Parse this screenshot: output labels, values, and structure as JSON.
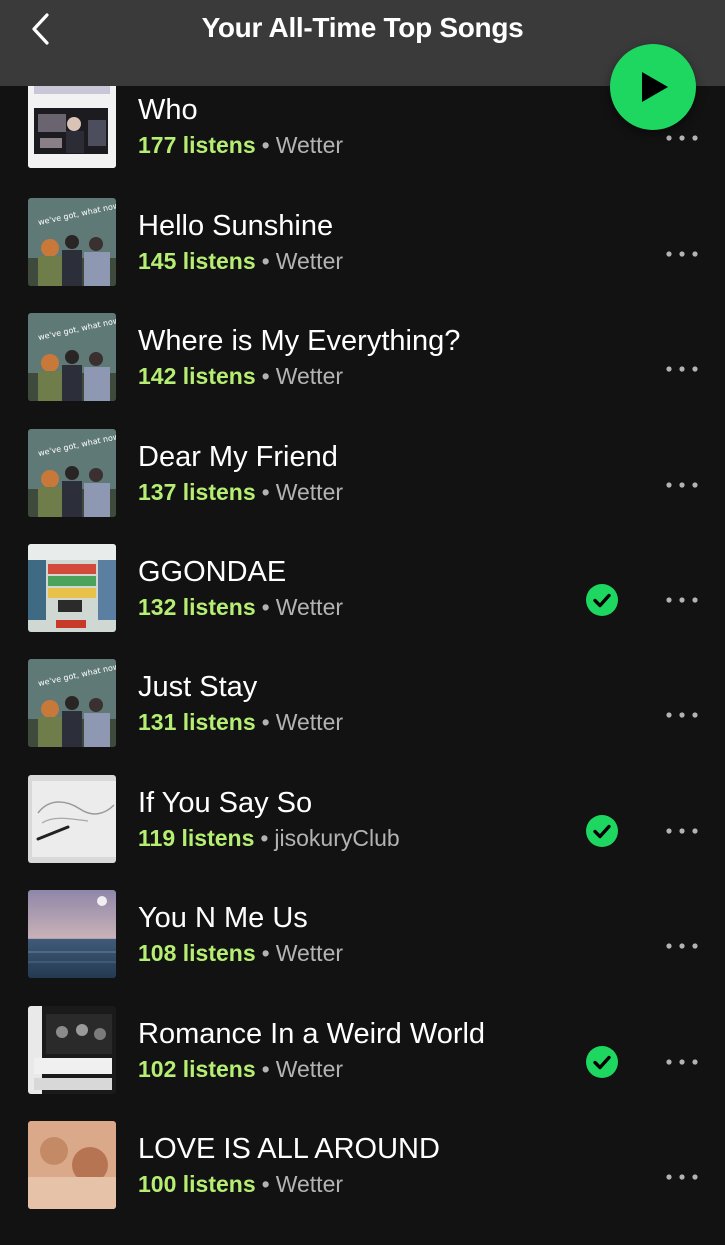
{
  "header": {
    "title": "Your All-Time Top Songs",
    "back_icon": "chevron-left-icon",
    "play_icon": "play-icon"
  },
  "colors": {
    "background": "#121212",
    "header": "#3a3a3a",
    "accent_green": "#1ed760",
    "listens_green": "#b5ee72",
    "secondary_text": "#b3b3b3"
  },
  "songs": [
    {
      "title": "Who",
      "listens": "177 listens",
      "artist": "Wetter",
      "downloaded": false
    },
    {
      "title": "Hello Sunshine",
      "listens": "145 listens",
      "artist": "Wetter",
      "downloaded": false
    },
    {
      "title": "Where is My Everything?",
      "listens": "142 listens",
      "artist": "Wetter",
      "downloaded": false
    },
    {
      "title": "Dear My Friend",
      "listens": "137 listens",
      "artist": "Wetter",
      "downloaded": false
    },
    {
      "title": "GGONDAE",
      "listens": "132 listens",
      "artist": "Wetter",
      "downloaded": true
    },
    {
      "title": "Just Stay",
      "listens": "131 listens",
      "artist": "Wetter",
      "downloaded": false
    },
    {
      "title": "If You Say So",
      "listens": "119 listens",
      "artist": "jisokuryClub",
      "downloaded": true
    },
    {
      "title": "You N Me Us",
      "listens": "108 listens",
      "artist": "Wetter",
      "downloaded": false
    },
    {
      "title": "Romance In a Weird World",
      "listens": "102 listens",
      "artist": "Wetter",
      "downloaded": true
    },
    {
      "title": "LOVE IS ALL AROUND",
      "listens": "100 listens",
      "artist": "Wetter",
      "downloaded": false
    }
  ],
  "separator": "•"
}
